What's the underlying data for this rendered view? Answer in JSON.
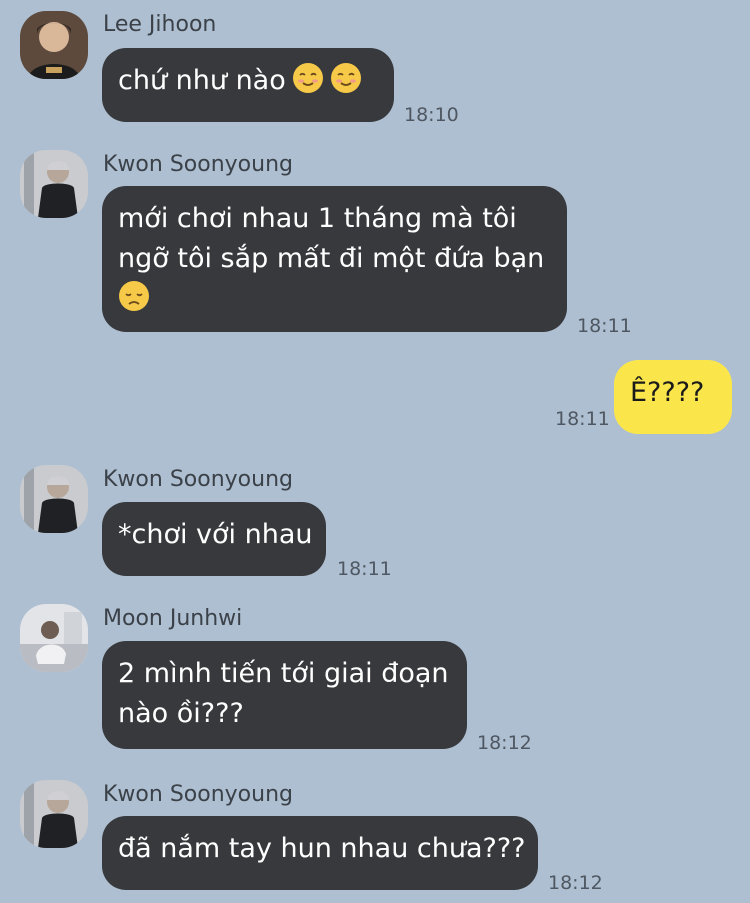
{
  "messages": [
    {
      "sender": "Lee Jihoon",
      "avatar_icon": "avatar-lee-jihoon-icon",
      "text": "chứ như nào",
      "emoji": [
        "smiling-face-icon",
        "smiling-face-icon"
      ],
      "time": "18:10"
    },
    {
      "sender": "Kwon Soonyoung",
      "avatar_icon": "avatar-kwon-soonyoung-icon",
      "lines": [
        "mới chơi nhau 1 tháng mà tôi",
        "ngỡ tôi sắp mất đi một đứa bạn"
      ],
      "emoji": [
        "disappointed-face-icon"
      ],
      "time": "18:11"
    },
    {
      "mine": true,
      "text": "Ê????",
      "time": "18:11"
    },
    {
      "sender": "Kwon Soonyoung",
      "avatar_icon": "avatar-kwon-soonyoung-icon",
      "text": "*chơi với nhau",
      "time": "18:11"
    },
    {
      "sender": "Moon Junhwi",
      "avatar_icon": "avatar-moon-junhwi-icon",
      "lines": [
        "2 mình tiến tới giai đoạn",
        "nào ồi???"
      ],
      "time": "18:12"
    },
    {
      "sender": "Kwon Soonyoung",
      "avatar_icon": "avatar-kwon-soonyoung-icon",
      "text": "đã nắm tay hun nhau chưa???",
      "time": "18:12"
    }
  ],
  "colors": {
    "background": "#aebfd1",
    "their_bubble": "#37393c",
    "my_bubble": "#fae64b",
    "emoji": "#f7c948"
  }
}
